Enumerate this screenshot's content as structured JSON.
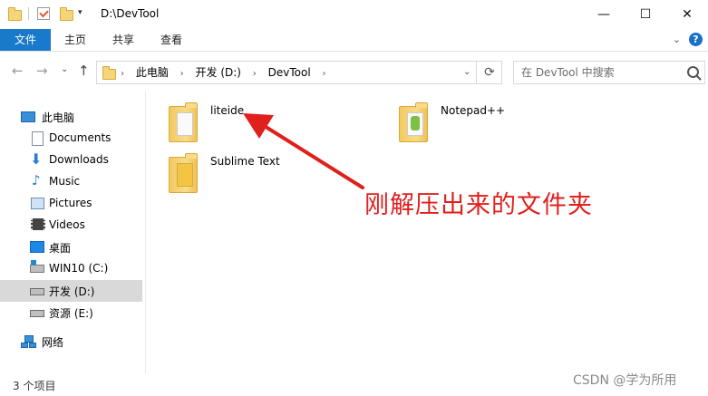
{
  "window": {
    "title_path": "D:\\DevTool",
    "controls": {
      "minimize": "—",
      "maximize": "☐",
      "close": "✕"
    }
  },
  "ribbon": {
    "tabs": [
      "文件",
      "主页",
      "共享",
      "查看"
    ],
    "help": "?"
  },
  "address": {
    "crumbs": [
      "此电脑",
      "开发 (D:)",
      "DevTool"
    ]
  },
  "search": {
    "placeholder": "在 DevTool 中搜索"
  },
  "sidebar": {
    "items": [
      {
        "label": "此电脑",
        "icon": "computer-icon"
      },
      {
        "label": "Documents",
        "icon": "documents-icon"
      },
      {
        "label": "Downloads",
        "icon": "download-arrow-icon"
      },
      {
        "label": "Music",
        "icon": "music-note-icon"
      },
      {
        "label": "Pictures",
        "icon": "pictures-icon"
      },
      {
        "label": "Videos",
        "icon": "film-icon"
      },
      {
        "label": "桌面",
        "icon": "desktop-icon"
      },
      {
        "label": "WIN10 (C:)",
        "icon": "windows-drive-icon"
      },
      {
        "label": "开发 (D:)",
        "icon": "drive-icon",
        "selected": true
      },
      {
        "label": "资源 (E:)",
        "icon": "drive-icon"
      },
      {
        "label": "网络",
        "icon": "network-icon"
      }
    ]
  },
  "files": [
    {
      "name": "liteide",
      "icon": "folder-icon"
    },
    {
      "name": "Notepad++",
      "icon": "notepadpp-folder-icon"
    },
    {
      "name": "Sublime Text",
      "icon": "sublime-folder-icon"
    }
  ],
  "annotation": {
    "text": "刚解压出来的文件夹",
    "color": "#e0201d"
  },
  "status": {
    "item_count": "3 个项目"
  },
  "watermark": "CSDN @学为所用",
  "colors": {
    "accent": "#1979ca",
    "selection": "#d9d9d9"
  }
}
